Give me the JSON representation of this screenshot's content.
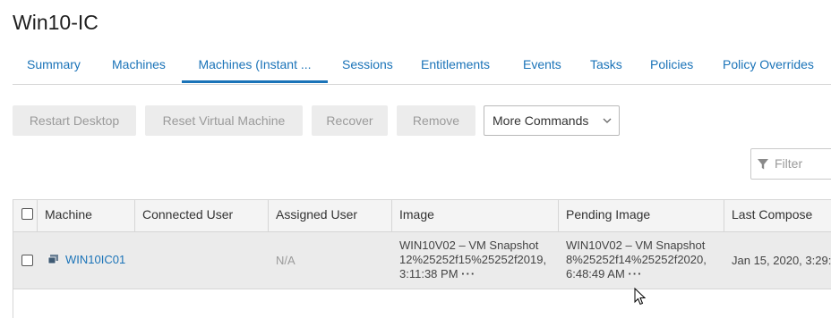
{
  "page": {
    "title": "Win10-IC"
  },
  "tabs": [
    {
      "label": "Summary"
    },
    {
      "label": "Machines"
    },
    {
      "label": "Machines (Instant ..."
    },
    {
      "label": "Sessions"
    },
    {
      "label": "Entitlements"
    },
    {
      "label": "Events"
    },
    {
      "label": "Tasks"
    },
    {
      "label": "Policies"
    },
    {
      "label": "Policy Overrides"
    }
  ],
  "active_tab": "Machines (Instant ...",
  "toolbar": {
    "restart_desktop": "Restart Desktop",
    "reset_vm": "Reset Virtual Machine",
    "recover": "Recover",
    "remove": "Remove",
    "more_commands": "More Commands"
  },
  "filter": {
    "placeholder": "Filter"
  },
  "table": {
    "columns": [
      "Machine",
      "Connected User",
      "Assigned User",
      "Image",
      "Pending Image",
      "Last Compose"
    ],
    "rows": [
      {
        "machine": "WIN10IC01",
        "connected_user": "",
        "assigned_user": "N/A",
        "image_line1": "WIN10V02 – VM Snapshot",
        "image_line2": "12%25252f15%25252f2019,",
        "image_line3": "3:11:38 PM",
        "pending_line1": "WIN10V02 – VM Snapshot",
        "pending_line2": "8%25252f14%25252f2020,",
        "pending_line3": "6:48:49 AM",
        "last_compose": "Jan 15, 2020, 3:29:2",
        "more": "···"
      }
    ]
  },
  "colors": {
    "accent": "#1a73b8",
    "disabled_bg": "#ececec",
    "row_bg": "#ebebeb"
  }
}
